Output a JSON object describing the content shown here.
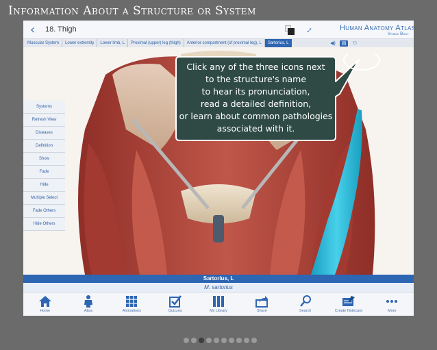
{
  "slide": {
    "title": "Information About a Structure or System"
  },
  "header": {
    "back_title": "18. Thigh",
    "brand_title": "Human Anatomy Atlas",
    "brand_sub": "Visible Body"
  },
  "breadcrumbs": [
    "Muscular System",
    "Lower extremity",
    "Lower limb, L",
    "Proximal (upper) leg (thigh)",
    "Anterior compartment (of proximal leg), L",
    "Sartorius, L"
  ],
  "info_icons": [
    "pronunciation-icon",
    "definition-icon",
    "pathologies-icon"
  ],
  "sidebar": {
    "items": [
      "Systems",
      "Refresh View",
      "Diseases",
      "Definition",
      "Show",
      "Fade",
      "Hide",
      "Multiple Select",
      "Fade Others",
      "Hide Others"
    ]
  },
  "callout": {
    "lines": [
      "Click any of the three icons next",
      "to the structure's name",
      "to hear its pronunciation,",
      "read a detailed definition,",
      "or learn about common pathologies",
      "associated with it."
    ]
  },
  "structure": {
    "name": "Sartorius, L",
    "latin": "M. sartorius"
  },
  "tabs": [
    {
      "label": "Home",
      "icon": "home-icon"
    },
    {
      "label": "Atlas",
      "icon": "person-icon"
    },
    {
      "label": "Animations",
      "icon": "grid-icon"
    },
    {
      "label": "Quizzes",
      "icon": "checkbox-icon"
    },
    {
      "label": "My Library",
      "icon": "library-icon"
    },
    {
      "label": "Share",
      "icon": "share-icon"
    },
    {
      "label": "Search",
      "icon": "search-icon"
    },
    {
      "label": "Create Notecard",
      "icon": "notecard-icon"
    },
    {
      "label": "More",
      "icon": "more-icon"
    }
  ],
  "pager": {
    "total": 10,
    "active": 3
  },
  "colors": {
    "accent": "#2d66b3",
    "callout_fill": "#2f4a44",
    "muscle": "#b5443a",
    "highlight": "#2bb8d6",
    "background": "#6b6b6b"
  }
}
